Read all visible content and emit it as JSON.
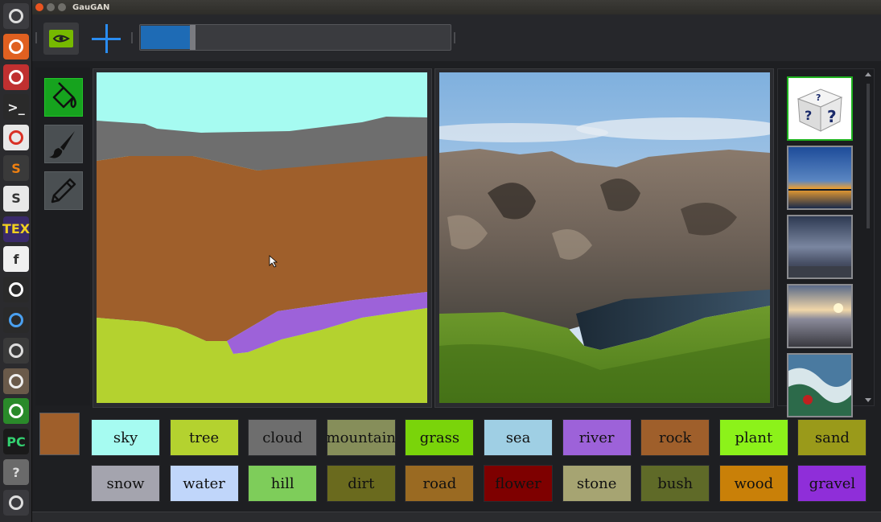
{
  "window": {
    "title": "GauGAN"
  },
  "colors": {
    "accent_blue": "#2a8cf0",
    "progress_blue": "#1e6bb5",
    "active_tool_green": "#16a31e",
    "nvidia_green": "#76b900",
    "current_label_color": "#9f5f2b"
  },
  "launcher": {
    "items": [
      {
        "icon": "ubuntu-dash-icon"
      },
      {
        "icon": "software-center-icon"
      },
      {
        "icon": "rocket-icon"
      },
      {
        "icon": "terminal-icon",
        "glyph": ">_"
      },
      {
        "icon": "chrome-icon"
      },
      {
        "icon": "sublime-text-icon",
        "glyph": "S"
      },
      {
        "icon": "slack-icon",
        "glyph": "S"
      },
      {
        "icon": "texmaker-icon",
        "glyph": "TEX"
      },
      {
        "icon": "formula-icon",
        "glyph": "f"
      },
      {
        "icon": "color-picker-icon"
      },
      {
        "icon": "paint-brush-app-icon"
      },
      {
        "icon": "gimp-icon"
      },
      {
        "icon": "file-manager-icon"
      },
      {
        "icon": "scilab-icon"
      },
      {
        "icon": "pycharm-icon",
        "glyph": "PC"
      },
      {
        "icon": "help-icon",
        "glyph": "?"
      },
      {
        "icon": "workspace-switcher-icon"
      }
    ]
  },
  "toolbar": {
    "progress_fraction": 0.17
  },
  "tools": [
    {
      "name": "fill-bucket-tool",
      "icon": "paint-bucket-icon",
      "active": true
    },
    {
      "name": "brush-tool",
      "icon": "paintbrush-icon",
      "active": false
    },
    {
      "name": "pencil-tool",
      "icon": "pencil-icon",
      "active": false
    }
  ],
  "gallery": {
    "items": [
      {
        "icon": "random-dice-icon",
        "selected": true
      },
      {
        "icon": "sunset-lake-style-thumbnail",
        "selected": false
      },
      {
        "icon": "cloudy-sea-style-thumbnail",
        "selected": false
      },
      {
        "icon": "sunset-beach-style-thumbnail",
        "selected": false
      },
      {
        "icon": "painting-style-thumbnail",
        "selected": false
      }
    ]
  },
  "labels": [
    {
      "text": "sky",
      "color": "#a6fbf1"
    },
    {
      "text": "tree",
      "color": "#b4d22f"
    },
    {
      "text": "cloud",
      "color": "#6e6e6e"
    },
    {
      "text": "mountain",
      "color": "#868e5a"
    },
    {
      "text": "grass",
      "color": "#7ad40a"
    },
    {
      "text": "sea",
      "color": "#9fcfe4"
    },
    {
      "text": "river",
      "color": "#9d62d9"
    },
    {
      "text": "rock",
      "color": "#9f5f2b"
    },
    {
      "text": "plant",
      "color": "#8cf21a"
    },
    {
      "text": "sand",
      "color": "#9a9a1a"
    },
    {
      "text": "snow",
      "color": "#a4a4ae"
    },
    {
      "text": "water",
      "color": "#c0d6fa"
    },
    {
      "text": "hill",
      "color": "#7ecd5a"
    },
    {
      "text": "dirt",
      "color": "#6a6a1e"
    },
    {
      "text": "road",
      "color": "#9a6a22"
    },
    {
      "text": "flower",
      "color": "#7e0000"
    },
    {
      "text": "stone",
      "color": "#a6a472"
    },
    {
      "text": "bush",
      "color": "#5f6a28"
    },
    {
      "text": "wood",
      "color": "#c98008"
    },
    {
      "text": "gravel",
      "color": "#8f2ed9"
    }
  ]
}
